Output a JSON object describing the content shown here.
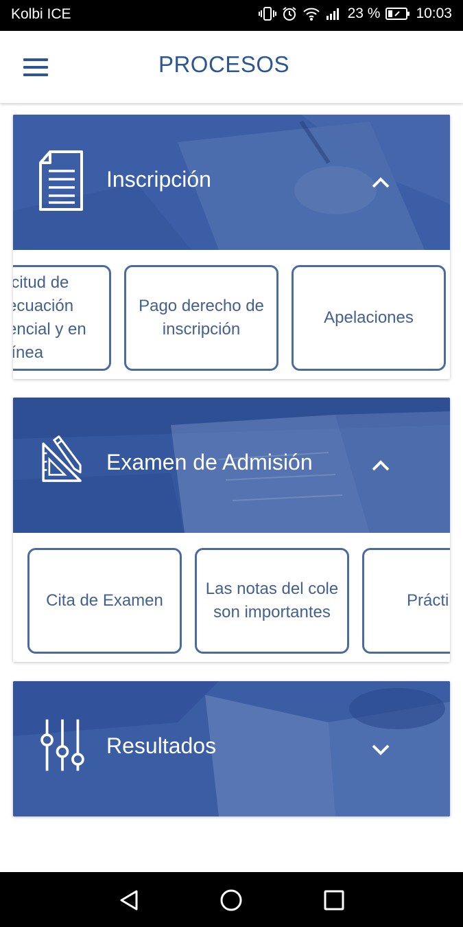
{
  "status_bar": {
    "carrier": "Kolbi ICE",
    "battery": "23 %",
    "time": "10:03"
  },
  "app_bar": {
    "title": "PROCESOS",
    "menu_icon": "hamburger-menu-icon"
  },
  "sections": [
    {
      "title": "Inscripción",
      "icon": "document-icon",
      "expanded": true,
      "items": [
        "icitud de ecuación encial y en línea",
        "Pago derecho de inscripción",
        "Apelaciones"
      ]
    },
    {
      "title": "Examen de Admisión",
      "icon": "pencil-ruler-icon",
      "expanded": true,
      "items": [
        "Cita de Examen",
        "Las notas del cole son importantes",
        "Prácti"
      ]
    },
    {
      "title": "Resultados",
      "icon": "sliders-icon",
      "expanded": false,
      "items": []
    }
  ],
  "colors": {
    "primary": "#2c5596",
    "card_header": "#3a5da4",
    "tile_border": "#4a6aa0"
  }
}
